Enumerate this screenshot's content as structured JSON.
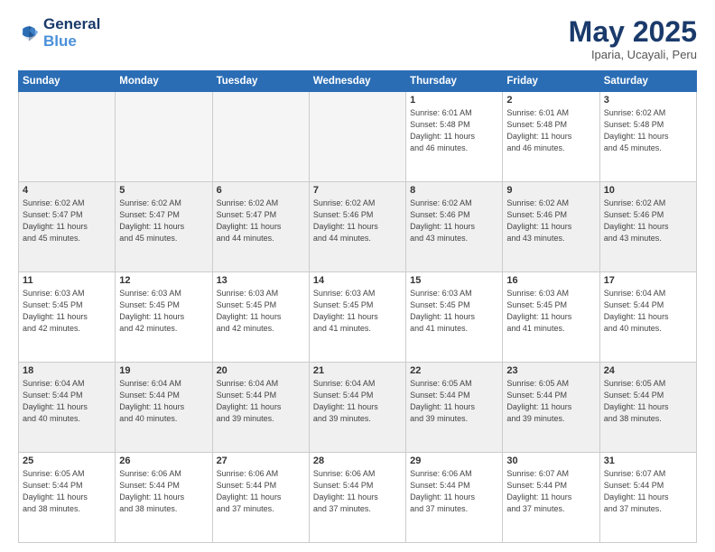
{
  "header": {
    "logo_line1": "General",
    "logo_line2": "Blue",
    "title": "May 2025",
    "location": "Iparia, Ucayali, Peru"
  },
  "weekdays": [
    "Sunday",
    "Monday",
    "Tuesday",
    "Wednesday",
    "Thursday",
    "Friday",
    "Saturday"
  ],
  "weeks": [
    [
      {
        "day": "",
        "info": ""
      },
      {
        "day": "",
        "info": ""
      },
      {
        "day": "",
        "info": ""
      },
      {
        "day": "",
        "info": ""
      },
      {
        "day": "1",
        "info": "Sunrise: 6:01 AM\nSunset: 5:48 PM\nDaylight: 11 hours\nand 46 minutes."
      },
      {
        "day": "2",
        "info": "Sunrise: 6:01 AM\nSunset: 5:48 PM\nDaylight: 11 hours\nand 46 minutes."
      },
      {
        "day": "3",
        "info": "Sunrise: 6:02 AM\nSunset: 5:48 PM\nDaylight: 11 hours\nand 45 minutes."
      }
    ],
    [
      {
        "day": "4",
        "info": "Sunrise: 6:02 AM\nSunset: 5:47 PM\nDaylight: 11 hours\nand 45 minutes."
      },
      {
        "day": "5",
        "info": "Sunrise: 6:02 AM\nSunset: 5:47 PM\nDaylight: 11 hours\nand 45 minutes."
      },
      {
        "day": "6",
        "info": "Sunrise: 6:02 AM\nSunset: 5:47 PM\nDaylight: 11 hours\nand 44 minutes."
      },
      {
        "day": "7",
        "info": "Sunrise: 6:02 AM\nSunset: 5:46 PM\nDaylight: 11 hours\nand 44 minutes."
      },
      {
        "day": "8",
        "info": "Sunrise: 6:02 AM\nSunset: 5:46 PM\nDaylight: 11 hours\nand 43 minutes."
      },
      {
        "day": "9",
        "info": "Sunrise: 6:02 AM\nSunset: 5:46 PM\nDaylight: 11 hours\nand 43 minutes."
      },
      {
        "day": "10",
        "info": "Sunrise: 6:02 AM\nSunset: 5:46 PM\nDaylight: 11 hours\nand 43 minutes."
      }
    ],
    [
      {
        "day": "11",
        "info": "Sunrise: 6:03 AM\nSunset: 5:45 PM\nDaylight: 11 hours\nand 42 minutes."
      },
      {
        "day": "12",
        "info": "Sunrise: 6:03 AM\nSunset: 5:45 PM\nDaylight: 11 hours\nand 42 minutes."
      },
      {
        "day": "13",
        "info": "Sunrise: 6:03 AM\nSunset: 5:45 PM\nDaylight: 11 hours\nand 42 minutes."
      },
      {
        "day": "14",
        "info": "Sunrise: 6:03 AM\nSunset: 5:45 PM\nDaylight: 11 hours\nand 41 minutes."
      },
      {
        "day": "15",
        "info": "Sunrise: 6:03 AM\nSunset: 5:45 PM\nDaylight: 11 hours\nand 41 minutes."
      },
      {
        "day": "16",
        "info": "Sunrise: 6:03 AM\nSunset: 5:45 PM\nDaylight: 11 hours\nand 41 minutes."
      },
      {
        "day": "17",
        "info": "Sunrise: 6:04 AM\nSunset: 5:44 PM\nDaylight: 11 hours\nand 40 minutes."
      }
    ],
    [
      {
        "day": "18",
        "info": "Sunrise: 6:04 AM\nSunset: 5:44 PM\nDaylight: 11 hours\nand 40 minutes."
      },
      {
        "day": "19",
        "info": "Sunrise: 6:04 AM\nSunset: 5:44 PM\nDaylight: 11 hours\nand 40 minutes."
      },
      {
        "day": "20",
        "info": "Sunrise: 6:04 AM\nSunset: 5:44 PM\nDaylight: 11 hours\nand 39 minutes."
      },
      {
        "day": "21",
        "info": "Sunrise: 6:04 AM\nSunset: 5:44 PM\nDaylight: 11 hours\nand 39 minutes."
      },
      {
        "day": "22",
        "info": "Sunrise: 6:05 AM\nSunset: 5:44 PM\nDaylight: 11 hours\nand 39 minutes."
      },
      {
        "day": "23",
        "info": "Sunrise: 6:05 AM\nSunset: 5:44 PM\nDaylight: 11 hours\nand 39 minutes."
      },
      {
        "day": "24",
        "info": "Sunrise: 6:05 AM\nSunset: 5:44 PM\nDaylight: 11 hours\nand 38 minutes."
      }
    ],
    [
      {
        "day": "25",
        "info": "Sunrise: 6:05 AM\nSunset: 5:44 PM\nDaylight: 11 hours\nand 38 minutes."
      },
      {
        "day": "26",
        "info": "Sunrise: 6:06 AM\nSunset: 5:44 PM\nDaylight: 11 hours\nand 38 minutes."
      },
      {
        "day": "27",
        "info": "Sunrise: 6:06 AM\nSunset: 5:44 PM\nDaylight: 11 hours\nand 37 minutes."
      },
      {
        "day": "28",
        "info": "Sunrise: 6:06 AM\nSunset: 5:44 PM\nDaylight: 11 hours\nand 37 minutes."
      },
      {
        "day": "29",
        "info": "Sunrise: 6:06 AM\nSunset: 5:44 PM\nDaylight: 11 hours\nand 37 minutes."
      },
      {
        "day": "30",
        "info": "Sunrise: 6:07 AM\nSunset: 5:44 PM\nDaylight: 11 hours\nand 37 minutes."
      },
      {
        "day": "31",
        "info": "Sunrise: 6:07 AM\nSunset: 5:44 PM\nDaylight: 11 hours\nand 37 minutes."
      }
    ]
  ]
}
